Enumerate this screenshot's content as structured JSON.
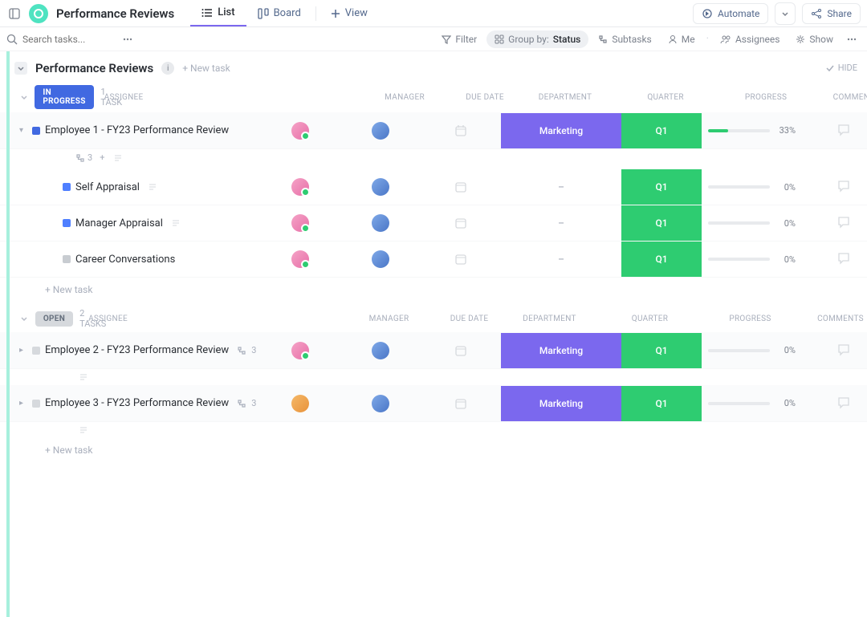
{
  "header": {
    "title": "Performance Reviews",
    "tabs": {
      "list": "List",
      "board": "Board",
      "view": "View"
    },
    "automate": "Automate",
    "share": "Share"
  },
  "toolbar": {
    "search_placeholder": "Search tasks...",
    "filter": "Filter",
    "group_by_label": "Group by:",
    "group_by_value": "Status",
    "subtasks": "Subtasks",
    "me": "Me",
    "assignees": "Assignees",
    "show": "Show"
  },
  "group": {
    "title": "Performance Reviews",
    "new_task": "+ New task",
    "hide": "HIDE"
  },
  "columns": {
    "assignee": "ASSIGNEE",
    "manager": "MANAGER",
    "due_date": "DUE DATE",
    "department": "DEPARTMENT",
    "quarter": "QUARTER",
    "progress": "PROGRESS",
    "comments": "COMMENTS"
  },
  "sections": [
    {
      "status": "IN PROGRESS",
      "pill_class": "pill-inprogress",
      "count_label": "1 TASK",
      "rows": [
        {
          "title": "Employee 1 - FY23 Performance Review",
          "subtask_count": "3",
          "assignee_class": "av-pink",
          "manager_class": "av-blue",
          "department": "Marketing",
          "dept_class": "dept-marketing",
          "quarter": "Q1",
          "progress_pct": 33,
          "progress_label": "33%",
          "subs": [
            {
              "title": "Self Appraisal",
              "box": "sb-bluesub",
              "dept": "–",
              "quarter": "Q1",
              "progress_label": "0%"
            },
            {
              "title": "Manager Appraisal",
              "box": "sb-bluesub",
              "dept": "–",
              "quarter": "Q1",
              "progress_label": "0%"
            },
            {
              "title": "Career Conversations",
              "box": "sb-greysub",
              "dept": "–",
              "quarter": "Q1",
              "progress_label": "0%"
            }
          ]
        }
      ],
      "new_task": "+ New task"
    },
    {
      "status": "OPEN",
      "pill_class": "pill-open",
      "count_label": "2 TASKS",
      "rows": [
        {
          "title": "Employee 2 - FY23 Performance Review",
          "subtask_count": "3",
          "assignee_class": "av-pink",
          "manager_class": "av-blue",
          "department": "Marketing",
          "dept_class": "dept-marketing",
          "quarter": "Q1",
          "progress_pct": 0,
          "progress_label": "0%"
        },
        {
          "title": "Employee 3 - FY23 Performance Review",
          "subtask_count": "3",
          "assignee_class": "av-orange",
          "manager_class": "av-blue",
          "department": "Marketing",
          "dept_class": "dept-marketing",
          "quarter": "Q1",
          "progress_pct": 0,
          "progress_label": "0%"
        }
      ],
      "new_task": "+ New task"
    }
  ]
}
